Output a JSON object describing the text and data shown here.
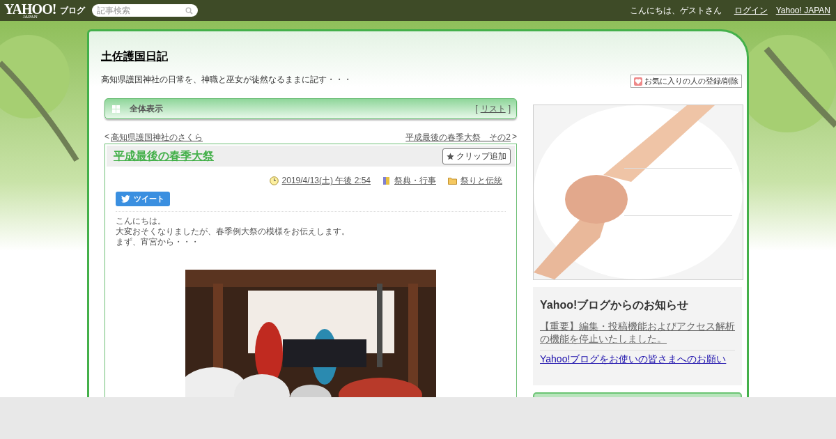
{
  "topbar": {
    "logo": "YAHOO!",
    "logo_sub": "JAPAN",
    "service": "ブログ",
    "search": {
      "placeholder": "記事検索"
    },
    "greeting": "こんにちは、ゲストさん",
    "links": [
      "ログイン",
      "Yahoo! JAPAN"
    ]
  },
  "blog": {
    "title": "土佐護国日記",
    "description": "高知県護国神社の日常を、神職と巫女が徒然なるままに記す・・・",
    "favorite_button": "お気に入りの人の登録/削除"
  },
  "section": {
    "title": "全体表示",
    "list_open": "[",
    "list_link": "リスト",
    "list_close": "]"
  },
  "nav": {
    "prev_mark": "<",
    "prev": "高知県護国神社のさくら",
    "next": "平成最後の春季大祭　その2",
    "next_mark": ">"
  },
  "post": {
    "title": "平成最後の春季大祭",
    "clip_button": "クリップ追加",
    "date": "2019/4/13(土) 午後 2:54",
    "category": "祭典・行事",
    "folder": "祭りと伝統",
    "tweet_button": "ツイート",
    "body": [
      "こんにちは。",
      "大変おそくなりましたが、春季例大祭の模様をお伝えします。",
      "まず、宵宮から・・・"
    ]
  },
  "sidebar": {
    "notice": {
      "title": "Yahoo!ブログからのお知らせ",
      "links": [
        {
          "text": "【重要】編集・投稿機能およびアクセス解析の機能を停止いたしました。",
          "kind": "important"
        },
        {
          "text": "Yahoo!ブログをお使いの皆さまへのお願い",
          "kind": "normal"
        }
      ]
    }
  }
}
